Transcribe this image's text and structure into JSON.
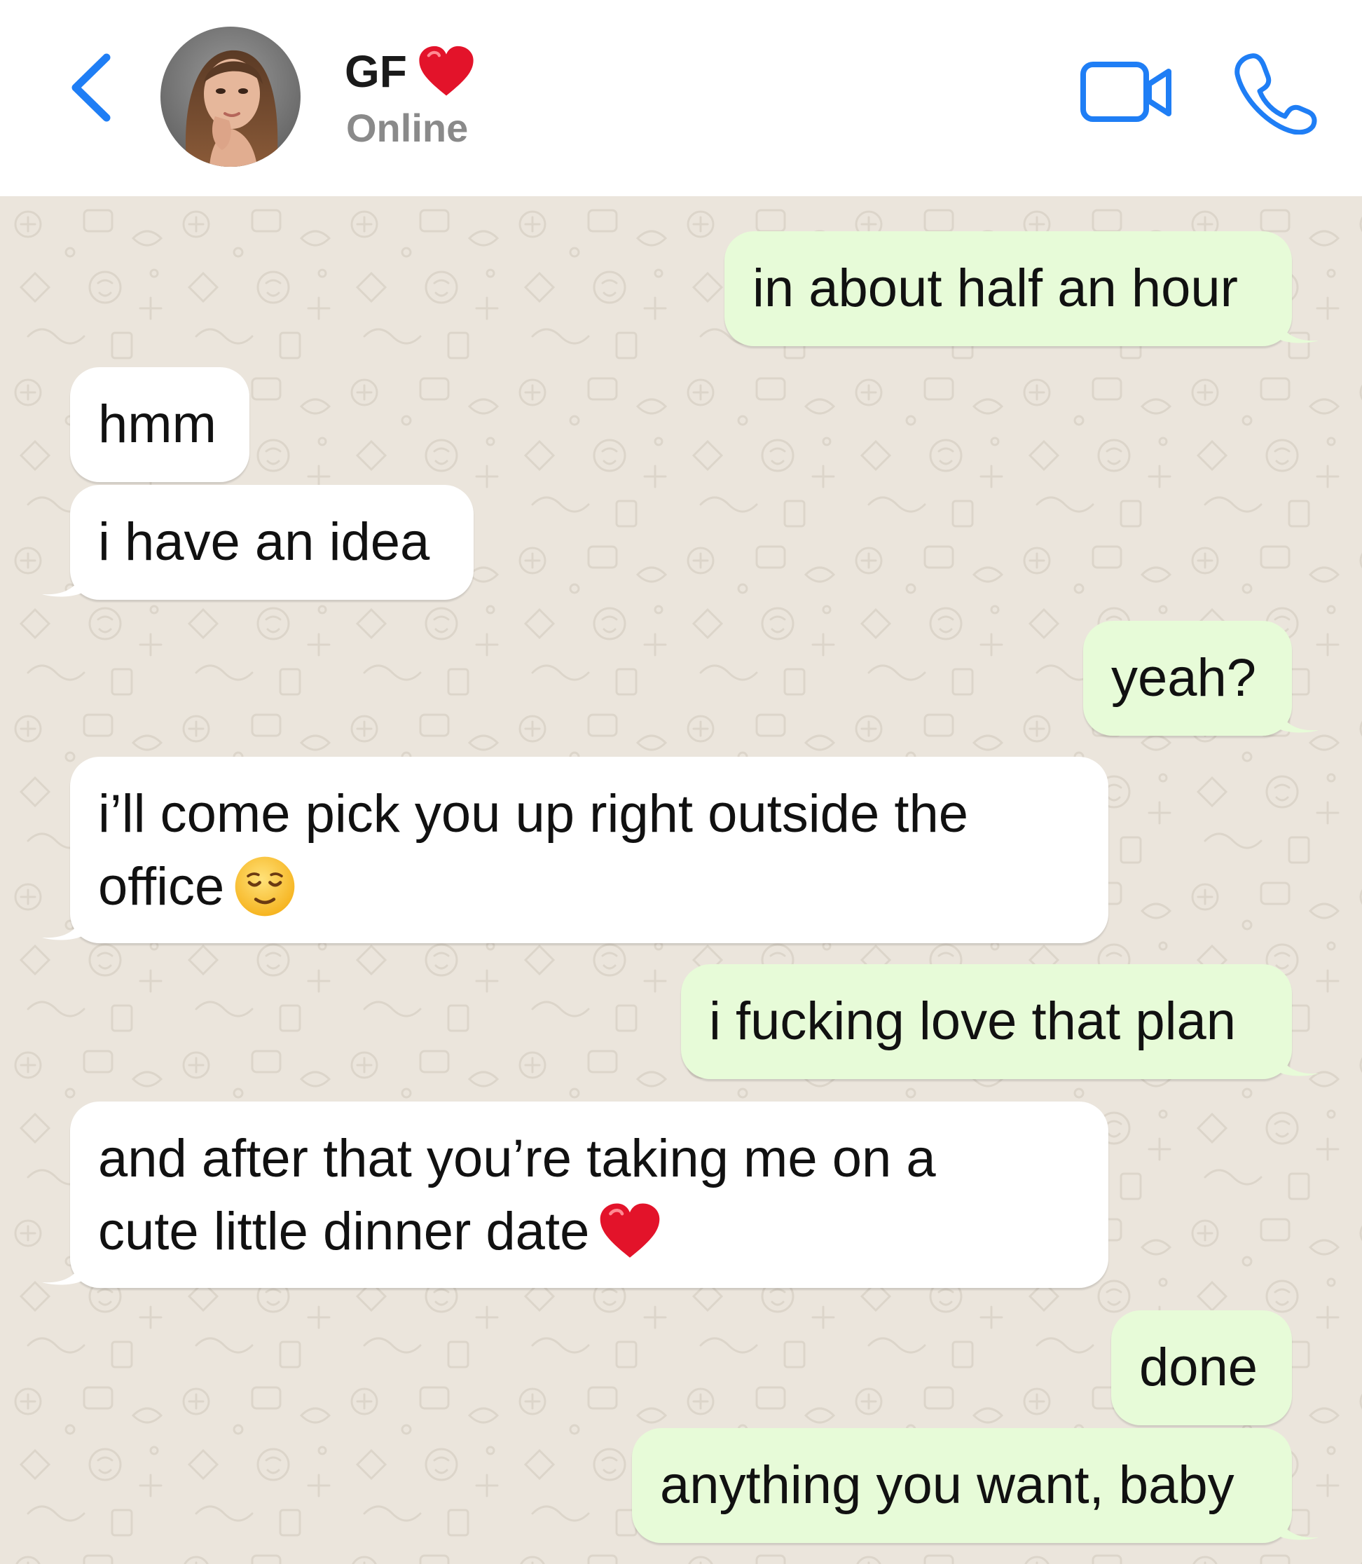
{
  "header": {
    "contact_name": "GF",
    "status": "Online",
    "name_emoji": "red-heart",
    "icons": [
      "chevron-left-icon",
      "video-camera-icon",
      "phone-icon"
    ],
    "accent_color": "#1f7ef5"
  },
  "messages": [
    {
      "direction": "outgoing",
      "text": "in about half an hour"
    },
    {
      "direction": "incoming",
      "text": "hmm"
    },
    {
      "direction": "incoming",
      "text": "i have an idea"
    },
    {
      "direction": "outgoing",
      "text": "yeah?"
    },
    {
      "direction": "incoming",
      "line1": "i’ll come pick you up right outside the",
      "line2": "office",
      "emoji": "relieved-face"
    },
    {
      "direction": "outgoing",
      "text": "i fucking love that plan"
    },
    {
      "direction": "incoming",
      "line1": "and after that you’re taking me on a",
      "line2": "cute little dinner date",
      "emoji": "red-heart"
    },
    {
      "direction": "outgoing",
      "text": "done"
    },
    {
      "direction": "outgoing",
      "text": "anything you want, baby"
    }
  ],
  "colors": {
    "outgoing_bubble": "#e7fbd8",
    "incoming_bubble": "#ffffff",
    "chat_background": "#ebe5dc",
    "status_text": "#8a8a8a"
  }
}
